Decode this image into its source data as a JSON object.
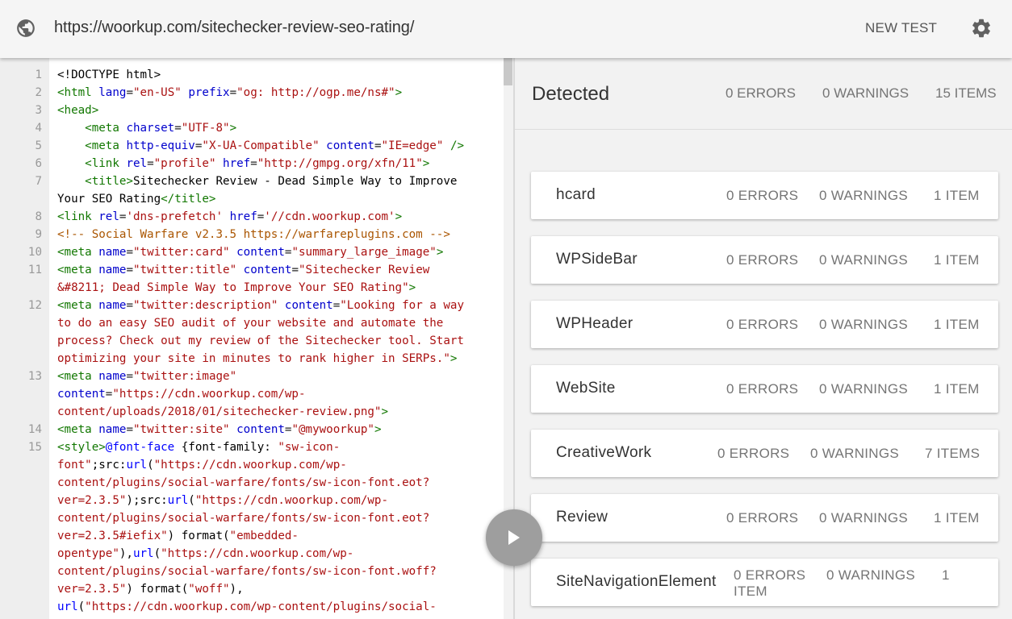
{
  "topbar": {
    "url": "https://woorkup.com/sitechecker-review-seo-rating/",
    "new_test": "NEW TEST",
    "globe_icon": "globe-icon",
    "settings_icon": "gear-icon"
  },
  "code": {
    "lines": [
      {
        "n": "1",
        "html": "<span class=\"pl\">&lt;!DOCTYPE html&gt;</span>"
      },
      {
        "n": "2",
        "html": "<span class=\"tg\">&lt;html</span> <span class=\"at\">lang</span>=<span class=\"st\">\"en-US\"</span> <span class=\"at\">prefix</span>=<span class=\"st\">\"og: http://ogp.me/ns#\"</span><span class=\"tg\">&gt;</span>"
      },
      {
        "n": "3",
        "html": "<span class=\"tg\">&lt;head&gt;</span>"
      },
      {
        "n": "4",
        "html": "    <span class=\"tg\">&lt;meta</span> <span class=\"at\">charset</span>=<span class=\"st\">\"UTF-8\"</span><span class=\"tg\">&gt;</span>"
      },
      {
        "n": "5",
        "html": "    <span class=\"tg\">&lt;meta</span> <span class=\"at\">http-equiv</span>=<span class=\"st\">\"X-UA-Compatible\"</span> <span class=\"at\">content</span>=<span class=\"st\">\"IE=edge\"</span> <span class=\"tg\">/&gt;</span>"
      },
      {
        "n": "6",
        "html": "    <span class=\"tg\">&lt;link</span> <span class=\"at\">rel</span>=<span class=\"st\">\"profile\"</span> <span class=\"at\">href</span>=<span class=\"st\">\"http://gmpg.org/xfn/11\"</span><span class=\"tg\">&gt;</span>"
      },
      {
        "n": "7",
        "html": "    <span class=\"tg\">&lt;title&gt;</span><span class=\"pl\">Sitechecker Review - Dead Simple Way to Improve</span>"
      },
      {
        "n": "",
        "html": "<span class=\"pl\">Your SEO Rating</span><span class=\"tg\">&lt;/title&gt;</span>"
      },
      {
        "n": "8",
        "html": "<span class=\"tg\">&lt;link</span> <span class=\"at\">rel</span>=<span class=\"st\">'dns-prefetch'</span> <span class=\"at\">href</span>=<span class=\"st\">'//cdn.woorkup.com'</span><span class=\"tg\">&gt;</span>"
      },
      {
        "n": "9",
        "html": "<span class=\"cm\">&lt;!-- Social Warfare v2.3.5 https://warfareplugins.com --&gt;</span>"
      },
      {
        "n": "10",
        "html": "<span class=\"tg\">&lt;meta</span> <span class=\"at\">name</span>=<span class=\"st\">\"twitter:card\"</span> <span class=\"at\">content</span>=<span class=\"st\">\"summary_large_image\"</span><span class=\"tg\">&gt;</span>"
      },
      {
        "n": "11",
        "html": "<span class=\"tg\">&lt;meta</span> <span class=\"at\">name</span>=<span class=\"st\">\"twitter:title\"</span> <span class=\"at\">content</span>=<span class=\"st\">\"Sitechecker Review</span>"
      },
      {
        "n": "",
        "html": "<span class=\"st\">&amp;#8211; Dead Simple Way to Improve Your SEO Rating\"</span><span class=\"tg\">&gt;</span>"
      },
      {
        "n": "12",
        "html": "<span class=\"tg\">&lt;meta</span> <span class=\"at\">name</span>=<span class=\"st\">\"twitter:description\"</span> <span class=\"at\">content</span>=<span class=\"st\">\"Looking for a way</span>"
      },
      {
        "n": "",
        "html": "<span class=\"st\">to do an easy SEO audit of your website and automate the</span>"
      },
      {
        "n": "",
        "html": "<span class=\"st\">process? Check out my review of the Sitechecker tool. Start</span>"
      },
      {
        "n": "",
        "html": "<span class=\"st\">optimizing your site in minutes to rank higher in SERPs.\"</span><span class=\"tg\">&gt;</span>"
      },
      {
        "n": "13",
        "html": "<span class=\"tg\">&lt;meta</span> <span class=\"at\">name</span>=<span class=\"st\">\"twitter:image\"</span>"
      },
      {
        "n": "",
        "html": "<span class=\"at\">content</span>=<span class=\"st\">\"https://cdn.woorkup.com/wp-</span>"
      },
      {
        "n": "",
        "html": "<span class=\"st\">content/uploads/2018/01/sitechecker-review.png\"</span><span class=\"tg\">&gt;</span>"
      },
      {
        "n": "14",
        "html": "<span class=\"tg\">&lt;meta</span> <span class=\"at\">name</span>=<span class=\"st\">\"twitter:site\"</span> <span class=\"at\">content</span>=<span class=\"st\">\"@mywoorkup\"</span><span class=\"tg\">&gt;</span>"
      },
      {
        "n": "15",
        "html": "<span class=\"tg\">&lt;style&gt;</span><span class=\"df\">@font-face</span> <span class=\"pl\">{font-family:</span> <span class=\"st\">\"sw-icon-</span>"
      },
      {
        "n": "",
        "html": "<span class=\"st\">font\"</span><span class=\"pl\">;src:</span><span class=\"df\">url</span><span class=\"pl\">(</span><span class=\"st\">\"https://cdn.woorkup.com/wp-</span>"
      },
      {
        "n": "",
        "html": "<span class=\"st\">content/plugins/social-warfare/fonts/sw-icon-font.eot?</span>"
      },
      {
        "n": "",
        "html": "<span class=\"st\">ver=2.3.5\"</span><span class=\"pl\">);src:</span><span class=\"df\">url</span><span class=\"pl\">(</span><span class=\"st\">\"https://cdn.woorkup.com/wp-</span>"
      },
      {
        "n": "",
        "html": "<span class=\"st\">content/plugins/social-warfare/fonts/sw-icon-font.eot?</span>"
      },
      {
        "n": "",
        "html": "<span class=\"st\">ver=2.3.5#iefix\"</span><span class=\"pl\">) format(</span><span class=\"st\">\"embedded-</span>"
      },
      {
        "n": "",
        "html": "<span class=\"st\">opentype\"</span><span class=\"pl\">),</span><span class=\"df\">url</span><span class=\"pl\">(</span><span class=\"st\">\"https://cdn.woorkup.com/wp-</span>"
      },
      {
        "n": "",
        "html": "<span class=\"st\">content/plugins/social-warfare/fonts/sw-icon-font.woff?</span>"
      },
      {
        "n": "",
        "html": "<span class=\"st\">ver=2.3.5\"</span><span class=\"pl\">) format(</span><span class=\"st\">\"woff\"</span><span class=\"pl\">),</span>"
      },
      {
        "n": "",
        "html": "<span class=\"df\">url</span><span class=\"pl\">(</span><span class=\"st\">\"https://cdn.woorkup.com/wp-content/plugins/social-</span>"
      }
    ]
  },
  "results": {
    "title": "Detected",
    "errors": "0 ERRORS",
    "warnings": "0 WARNINGS",
    "items": "15 ITEMS",
    "cards": [
      {
        "name": "hcard",
        "errors": "0 ERRORS",
        "warnings": "0 WARNINGS",
        "items": "1 ITEM"
      },
      {
        "name": "WPSideBar",
        "errors": "0 ERRORS",
        "warnings": "0 WARNINGS",
        "items": "1 ITEM"
      },
      {
        "name": "WPHeader",
        "errors": "0 ERRORS",
        "warnings": "0 WARNINGS",
        "items": "1 ITEM"
      },
      {
        "name": "WebSite",
        "errors": "0 ERRORS",
        "warnings": "0 WARNINGS",
        "items": "1 ITEM"
      },
      {
        "name": "CreativeWork",
        "errors": "0 ERRORS",
        "warnings": "0 WARNINGS",
        "items": "7 ITEMS"
      },
      {
        "name": "Review",
        "errors": "0 ERRORS",
        "warnings": "0 WARNINGS",
        "items": "1 ITEM"
      },
      {
        "name": "SiteNavigationElement",
        "errors": "0 ERRORS",
        "warnings": "0 WARNINGS",
        "items": "1 ITEM"
      }
    ]
  },
  "play_icon": "play-icon"
}
